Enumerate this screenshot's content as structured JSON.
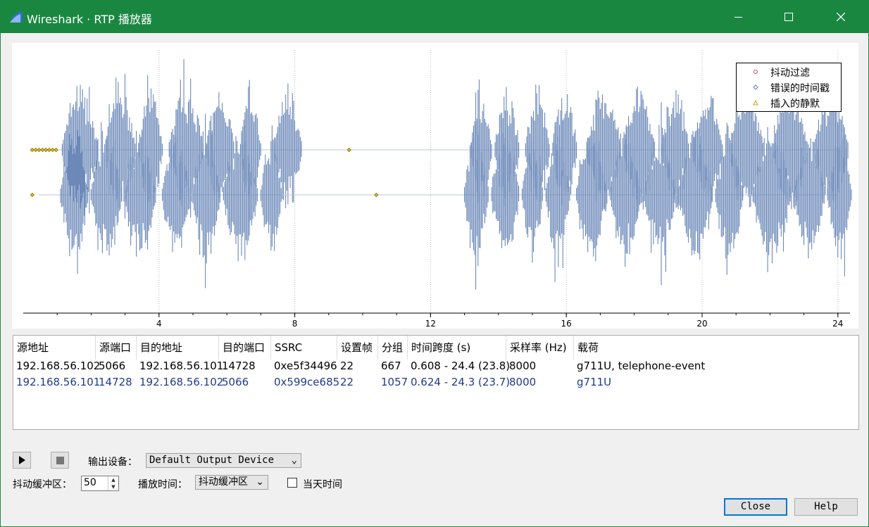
{
  "window": {
    "title": "Wireshark · RTP 播放器",
    "controls": {
      "minimize": "—",
      "maximize": "☐",
      "close": "✕"
    }
  },
  "legend": [
    {
      "label": "抖动过滤",
      "color": "#c0504d",
      "icon": "circle-marker-icon"
    },
    {
      "label": "错误的时间戳",
      "color": "#4f81bd",
      "icon": "diamond-marker-icon"
    },
    {
      "label": "插入的静默",
      "color": "#d4a017",
      "icon": "triangle-marker-icon"
    }
  ],
  "chart_data": {
    "type": "line",
    "xlabel": "",
    "ylabel": "",
    "x_ticks": [
      "4",
      "8",
      "12",
      "16",
      "20",
      "24"
    ],
    "xlim": [
      0,
      24.6
    ],
    "grid": "vertical dotted at major ticks",
    "series": [
      {
        "baseline_level": "upper",
        "time_span_s": [
          0.608,
          24.4
        ],
        "color": "#6b88b8",
        "bursts_s": [
          [
            1.15,
            2.2
          ],
          [
            2.4,
            3.3
          ],
          [
            3.4,
            4.1
          ],
          [
            4.3,
            5.3
          ],
          [
            5.4,
            6.2
          ],
          [
            6.4,
            7.0
          ],
          [
            7.4,
            8.2
          ],
          [
            13.2,
            13.8
          ],
          [
            13.9,
            14.6
          ],
          [
            14.8,
            15.5
          ],
          [
            15.6,
            16.3
          ],
          [
            16.6,
            17.6
          ],
          [
            17.7,
            18.6
          ],
          [
            18.8,
            19.6
          ],
          [
            19.7,
            20.6
          ],
          [
            20.8,
            21.8
          ],
          [
            22.1,
            23.1
          ],
          [
            23.3,
            24.3
          ]
        ],
        "markers": [
          {
            "type": "插入的静默",
            "x": 0.1
          },
          {
            "type": "插入的静默",
            "x": 0.2
          },
          {
            "type": "插入的静默",
            "x": 0.3
          },
          {
            "type": "插入的静默",
            "x": 0.4
          },
          {
            "type": "插入的静默",
            "x": 0.5
          },
          {
            "type": "插入的静默",
            "x": 0.6
          },
          {
            "type": "插入的静默",
            "x": 0.7
          },
          {
            "type": "插入的静默",
            "x": 0.8
          },
          {
            "type": "插入的静默",
            "x": 9.6
          }
        ]
      },
      {
        "baseline_level": "lower",
        "time_span_s": [
          0.624,
          24.3
        ],
        "color": "#6b88b8",
        "bursts_s": [
          [
            1.1,
            1.9
          ],
          [
            2.0,
            2.9
          ],
          [
            3.0,
            3.9
          ],
          [
            4.1,
            4.9
          ],
          [
            5.0,
            5.8
          ],
          [
            5.9,
            6.9
          ],
          [
            7.0,
            7.6
          ],
          [
            13.0,
            13.7
          ],
          [
            13.8,
            14.6
          ],
          [
            14.7,
            15.3
          ],
          [
            15.4,
            16.1
          ],
          [
            16.3,
            17.2
          ],
          [
            17.3,
            18.2
          ],
          [
            18.3,
            19.2
          ],
          [
            19.3,
            20.3
          ],
          [
            20.4,
            21.2
          ],
          [
            21.5,
            22.6
          ],
          [
            22.7,
            23.6
          ],
          [
            23.7,
            24.4
          ]
        ],
        "markers": [
          {
            "type": "插入的静默",
            "x": 0.1
          },
          {
            "type": "插入的静默",
            "x": 10.4
          }
        ]
      }
    ]
  },
  "table": {
    "headers": [
      "源地址",
      "源端口",
      "目的地址",
      "目的端口",
      "SSRC",
      "设置帧",
      "分组",
      "时间跨度 (s)",
      "采样率 (Hz)",
      "载荷"
    ],
    "rows": [
      [
        "192.168.56.102",
        "5066",
        "192.168.56.101",
        "14728",
        "0xe5f34496",
        "22",
        "667",
        "0.608 - 24.4 (23.8)",
        "8000",
        "g711U, telephone-event"
      ],
      [
        "192.168.56.101",
        "14728",
        "192.168.56.102",
        "5066",
        "0x599ce685",
        "22",
        "1057",
        "0.624 - 24.3 (23.7)",
        "8000",
        "g711U"
      ]
    ]
  },
  "controls": {
    "output_label": "输出设备：",
    "output_device": "Default Output Device",
    "jitter_label": "抖动缓冲区：",
    "jitter_value": "50",
    "playback_label": "播放时间：",
    "playback_mode": "抖动缓冲区",
    "today_label": "当天时间",
    "close_label": "Close",
    "help_label": "Help"
  }
}
